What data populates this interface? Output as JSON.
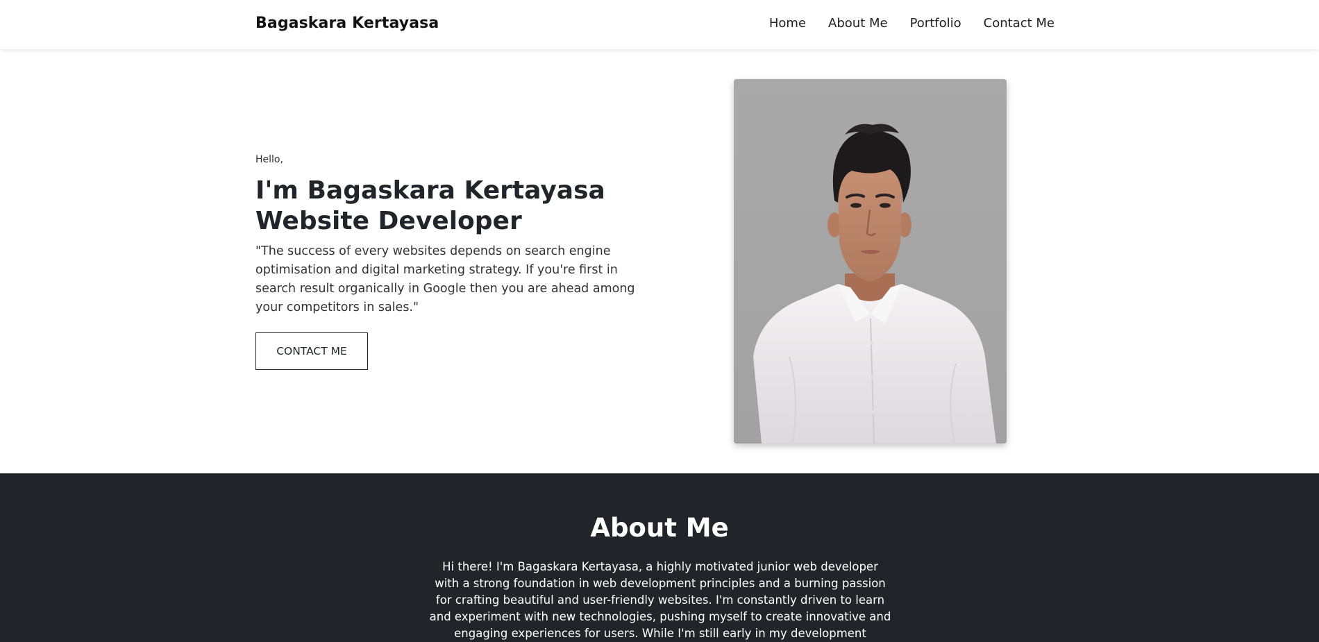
{
  "nav": {
    "brand": "Bagaskara Kertayasa",
    "links": [
      "Home",
      "About Me",
      "Portfolio",
      "Contact Me"
    ]
  },
  "hero": {
    "greeting": "Hello,",
    "title_line1": "I'm Bagaskara Kertayasa",
    "title_line2": "Website Developer",
    "quote": "\"The success of every websites depends on search engine optimisation and digital marketing strategy. If you're first in search result organically in Google then you are ahead among your competitors in sales.\"",
    "cta_label": "CONTACT ME"
  },
  "about": {
    "title": "About Me",
    "text": "Hi there! I'm Bagaskara Kertayasa, a highly motivated junior web developer with a strong foundation in web development principles and a burning passion for crafting beautiful and user-friendly websites. I'm constantly driven to learn and experiment with new technologies, pushing myself to create innovative and engaging experiences for users. While I'm still early in my development journey, I"
  },
  "colors": {
    "dark_section": "#212529",
    "portrait_background": "#a7a7a7",
    "text_primary": "#212529"
  }
}
